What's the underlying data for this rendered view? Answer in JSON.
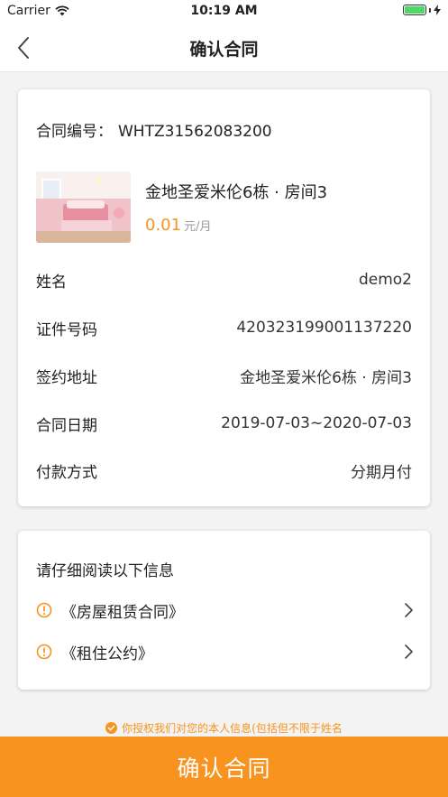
{
  "status": {
    "carrier": "Carrier",
    "time": "10:19 AM"
  },
  "nav": {
    "title": "确认合同"
  },
  "contract": {
    "number_label": "合同编号：",
    "number": "WHTZ31562083200",
    "room_title": "金地圣爱米伦6栋 · 房间3",
    "price": "0.01",
    "price_unit": "元/月",
    "fields": [
      {
        "label": "姓名",
        "value": "demo2"
      },
      {
        "label": "证件号码",
        "value": "420323199001137220"
      },
      {
        "label": "签约地址",
        "value": "金地圣爱米伦6栋 · 房间3"
      },
      {
        "label": "合同日期",
        "value": "2019-07-03~2020-07-03"
      },
      {
        "label": "付款方式",
        "value": "分期月付"
      }
    ]
  },
  "notice": {
    "title": "请仔细阅读以下信息",
    "docs": [
      {
        "label": "《房屋租赁合同》"
      },
      {
        "label": "《租住公约》"
      }
    ]
  },
  "auth_note": "你授权我们对您的本人信息(包括但不限于姓名",
  "confirm_label": "确认合同",
  "colors": {
    "accent": "#f7931e",
    "background": "#f3f3f3"
  },
  "icons": [
    "wifi-icon",
    "battery-icon",
    "back-icon",
    "warning-icon",
    "chevron-right-icon",
    "check-circle-icon"
  ]
}
